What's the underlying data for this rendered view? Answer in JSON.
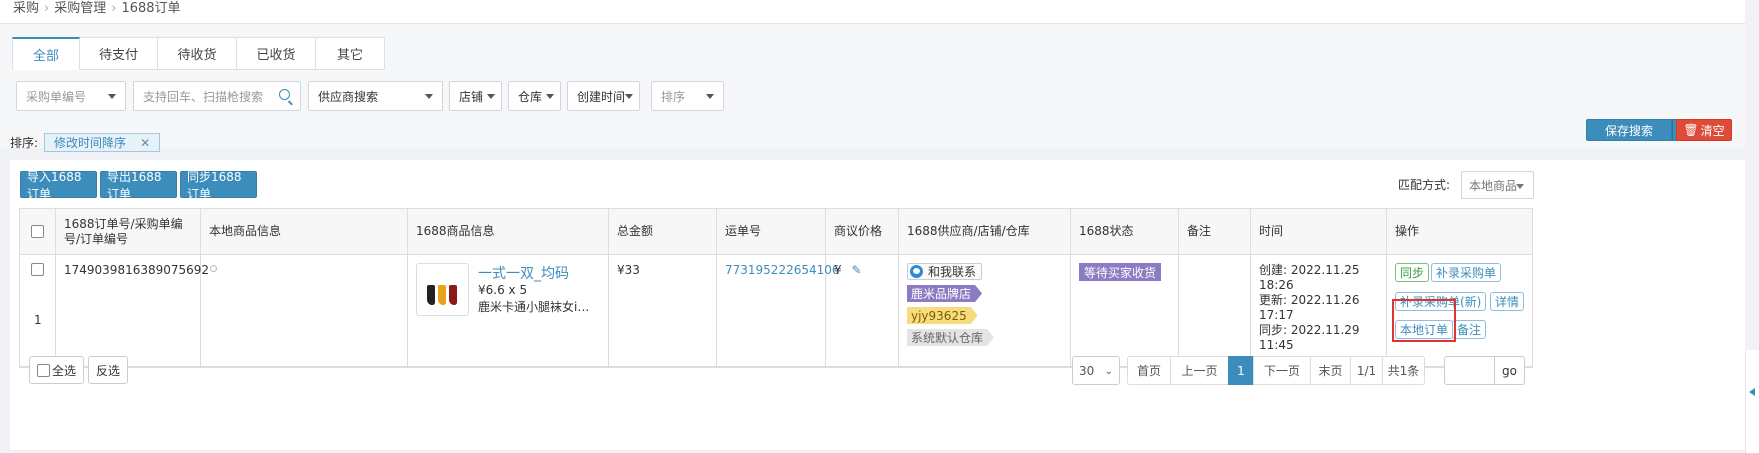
{
  "breadcrumb": [
    "采购",
    "采购管理",
    "1688订单"
  ],
  "tabs": [
    {
      "label": "全部",
      "active": true
    },
    {
      "label": "待支付",
      "active": false
    },
    {
      "label": "待收货",
      "active": false
    },
    {
      "label": "已收货",
      "active": false
    },
    {
      "label": "其它",
      "active": false
    }
  ],
  "filters": {
    "order_no_select": "采购单编号",
    "search_placeholder": "支持回车、扫描枪搜索",
    "supplier_select": "供应商搜索",
    "shop": "店铺",
    "warehouse": "仓库",
    "created_time": "创建时间",
    "sort_select": "排序"
  },
  "sort": {
    "label": "排序:",
    "chip": "修改时间降序"
  },
  "buttons": {
    "save_search": "保存搜索",
    "clear": "清空",
    "import": "导入1688订单",
    "export": "导出1688订单",
    "sync": "同步1688订单"
  },
  "match": {
    "label": "匹配方式:",
    "value": "本地商品"
  },
  "table": {
    "headers": [
      "1688订单号/采购单编号/订单编号",
      "本地商品信息",
      "1688商品信息",
      "总金额",
      "运单号",
      "商议价格",
      "1688供应商/店铺/仓库",
      "1688状态",
      "备注",
      "时间",
      "操作"
    ],
    "row": {
      "order_no": "1749039816389075692",
      "row_index": "1",
      "product_title": "一式一双_均码",
      "product_meta": "¥6.6 x 5",
      "product_name": "鹿米卡通小腿袜女in...",
      "total": "¥33",
      "waybill": "773195222654106",
      "negotiate_prefix": "¥",
      "contact": "和我联系",
      "shop_tag": "鹿米品牌店",
      "supplier_tag": "yjy93625",
      "warehouse_tag": "系统默认仓库",
      "status": "等待买家收货",
      "created": "创建: 2022.11.25 18:26",
      "updated": "更新: 2022.11.26 17:17",
      "synced": "同步: 2022.11.29 11:45",
      "ops": {
        "sync": "同步",
        "add_purchase": "补录采购单",
        "add_purchase_new": "补录采购单(新)",
        "detail": "详情",
        "local_order": "本地订单",
        "remark": "备注"
      }
    }
  },
  "footer": {
    "select_all": "全选",
    "invert": "反选",
    "page_size": "30",
    "first": "首页",
    "prev": "上一页",
    "current": "1",
    "next": "下一页",
    "last": "末页",
    "page_info": "1/1",
    "total": "共1条",
    "go": "go"
  },
  "colors": {
    "primary": "#3c8dbc",
    "danger": "#dd4b39",
    "status": "#8c7bc3"
  }
}
